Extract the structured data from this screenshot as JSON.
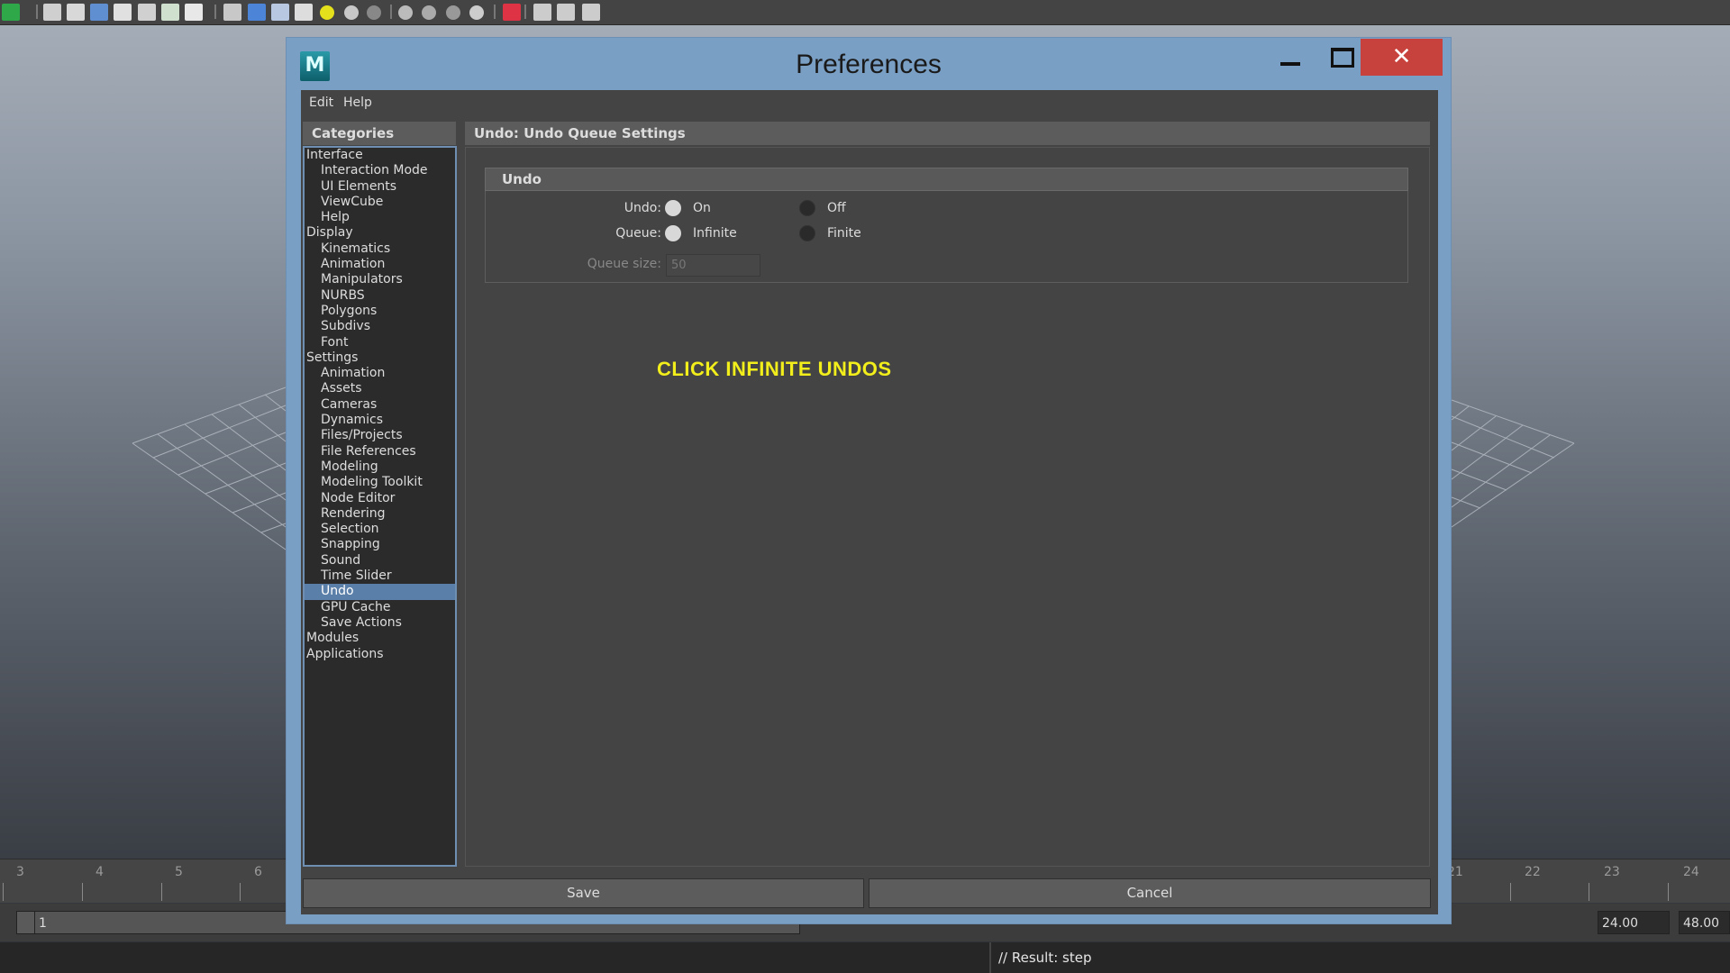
{
  "shelf": {
    "icons": [
      "maya-logo-icon",
      "wireframe-icon",
      "smooth-shade-icon",
      "shaded-icon",
      "textured-icon",
      "xray-icon",
      "uv-icon",
      "text-icon",
      "cube-icon",
      "blue-cube-icon",
      "wire-cube-icon",
      "checker-icon",
      "yellow-light-icon",
      "sphere-icon",
      "dark-sphere-icon",
      "camera-icon",
      "lens-icon",
      "half-sphere-icon",
      "gradient-icon",
      "select-tool-icon",
      "box-icon",
      "duplicate-icon",
      "share-icon"
    ]
  },
  "timeline": {
    "left_ticks": [
      "3",
      "4",
      "5",
      "6"
    ],
    "right_ticks": [
      "21",
      "22",
      "23",
      "24"
    ],
    "range_start": "1",
    "range_end": "24.00",
    "anim_end": "48.00",
    "hidden_mid": "24"
  },
  "command_line": {
    "result": "// Result: step"
  },
  "dialog": {
    "title": "Preferences",
    "close_symbol": "✕",
    "menu": [
      "Edit",
      "Help"
    ],
    "categories_header": "Categories",
    "categories": [
      {
        "label": "Interface",
        "level": 0
      },
      {
        "label": "Interaction Mode",
        "level": 1
      },
      {
        "label": "UI Elements",
        "level": 1
      },
      {
        "label": "ViewCube",
        "level": 1
      },
      {
        "label": "Help",
        "level": 1
      },
      {
        "label": "Display",
        "level": 0
      },
      {
        "label": "Kinematics",
        "level": 1
      },
      {
        "label": "Animation",
        "level": 1
      },
      {
        "label": "Manipulators",
        "level": 1
      },
      {
        "label": "NURBS",
        "level": 1
      },
      {
        "label": "Polygons",
        "level": 1
      },
      {
        "label": "Subdivs",
        "level": 1
      },
      {
        "label": "Font",
        "level": 1
      },
      {
        "label": "Settings",
        "level": 0
      },
      {
        "label": "Animation",
        "level": 1
      },
      {
        "label": "Assets",
        "level": 1
      },
      {
        "label": "Cameras",
        "level": 1
      },
      {
        "label": "Dynamics",
        "level": 1
      },
      {
        "label": "Files/Projects",
        "level": 1
      },
      {
        "label": "File References",
        "level": 1
      },
      {
        "label": "Modeling",
        "level": 1
      },
      {
        "label": "Modeling Toolkit",
        "level": 1
      },
      {
        "label": "Node Editor",
        "level": 1
      },
      {
        "label": "Rendering",
        "level": 1
      },
      {
        "label": "Selection",
        "level": 1
      },
      {
        "label": "Snapping",
        "level": 1
      },
      {
        "label": "Sound",
        "level": 1
      },
      {
        "label": "Time Slider",
        "level": 1
      },
      {
        "label": "Undo",
        "level": 1,
        "selected": true
      },
      {
        "label": "GPU Cache",
        "level": 1
      },
      {
        "label": "Save Actions",
        "level": 1
      },
      {
        "label": "Modules",
        "level": 0
      },
      {
        "label": "Applications",
        "level": 0
      }
    ],
    "settings_header": "Undo: Undo Queue Settings",
    "frame_title": "Undo",
    "undo": {
      "label": "Undo:",
      "opt_on": "On",
      "opt_off": "Off",
      "selected": "On"
    },
    "queue": {
      "label": "Queue:",
      "opt_infinite": "Infinite",
      "opt_finite": "Finite",
      "selected": "Infinite"
    },
    "queue_size": {
      "label": "Queue size:",
      "value": "50"
    },
    "annotation": "CLICK INFINITE UNDOS",
    "save_label": "Save",
    "cancel_label": "Cancel"
  },
  "colors": {
    "accent": "#5a7fa8",
    "window_frame": "#7a9fc5",
    "close_button": "#c7423c",
    "annotation": "#f2ee1c"
  }
}
